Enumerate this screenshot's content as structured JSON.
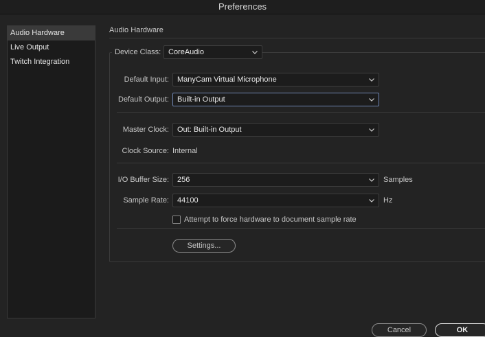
{
  "window": {
    "title": "Preferences"
  },
  "sidebar": {
    "items": [
      {
        "label": "Audio Hardware",
        "active": true
      },
      {
        "label": "Live Output",
        "active": false
      },
      {
        "label": "Twitch Integration",
        "active": false
      }
    ]
  },
  "panel": {
    "title": "Audio Hardware",
    "device_class": {
      "label": "Device Class:",
      "value": "CoreAudio"
    },
    "default_input": {
      "label": "Default Input:",
      "value": "ManyCam Virtual Microphone"
    },
    "default_output": {
      "label": "Default Output:",
      "value": "Built-in Output"
    },
    "master_clock": {
      "label": "Master Clock:",
      "value": "Out: Built-in Output"
    },
    "clock_source": {
      "label": "Clock Source:",
      "value": "Internal"
    },
    "io_buffer": {
      "label": "I/O Buffer Size:",
      "value": "256",
      "unit": "Samples"
    },
    "sample_rate": {
      "label": "Sample Rate:",
      "value": "44100",
      "unit": "Hz"
    },
    "force_rate": {
      "label": "Attempt to force hardware to document sample rate",
      "checked": false
    },
    "settings_button": "Settings..."
  },
  "footer": {
    "cancel": "Cancel",
    "ok": "OK"
  },
  "icons": {
    "dropdown": "chevron-down-icon"
  },
  "colors": {
    "focus_border": "#6f86b4",
    "active_item": "#3a3a3a"
  }
}
